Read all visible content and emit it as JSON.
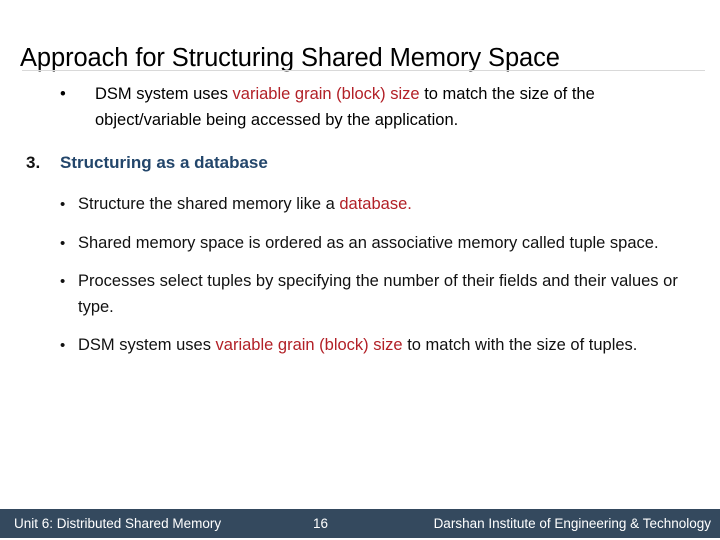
{
  "slide": {
    "title": "Approach for Structuring Shared Memory Space",
    "accent_red": "#B22027",
    "heading_blue": "#23466B",
    "footer_bar_color": "#34495E",
    "divider_color": "#d9d9d9"
  },
  "content": {
    "carryover_bullet": {
      "marker": "•",
      "text_part1": "DSM system uses ",
      "highlight": "variable grain (block) size",
      "text_part2": " to match the size of the object/variable being accessed by the application."
    },
    "numbered_heading": {
      "number": "3.",
      "label": "Structuring as a database"
    },
    "sub_bullets": [
      {
        "marker": "•",
        "text_part1": "Structure the shared memory like a ",
        "highlight": "database.",
        "text_part2": ""
      },
      {
        "marker": "•",
        "text_part1": "Shared memory space is ordered as an associative memory called tuple space.",
        "highlight": "",
        "text_part2": ""
      },
      {
        "marker": "•",
        "text_part1": "Processes select tuples by specifying the number of their fields and their values or type.",
        "highlight": "",
        "text_part2": ""
      },
      {
        "marker": "•",
        "text_part1": "DSM system uses ",
        "highlight": "variable grain (block) size",
        "text_part2": " to match with the size of tuples."
      }
    ]
  },
  "footer": {
    "left": "Unit 6: Distributed Shared Memory",
    "page": "16",
    "right": "Darshan Institute of Engineering & Technology"
  }
}
